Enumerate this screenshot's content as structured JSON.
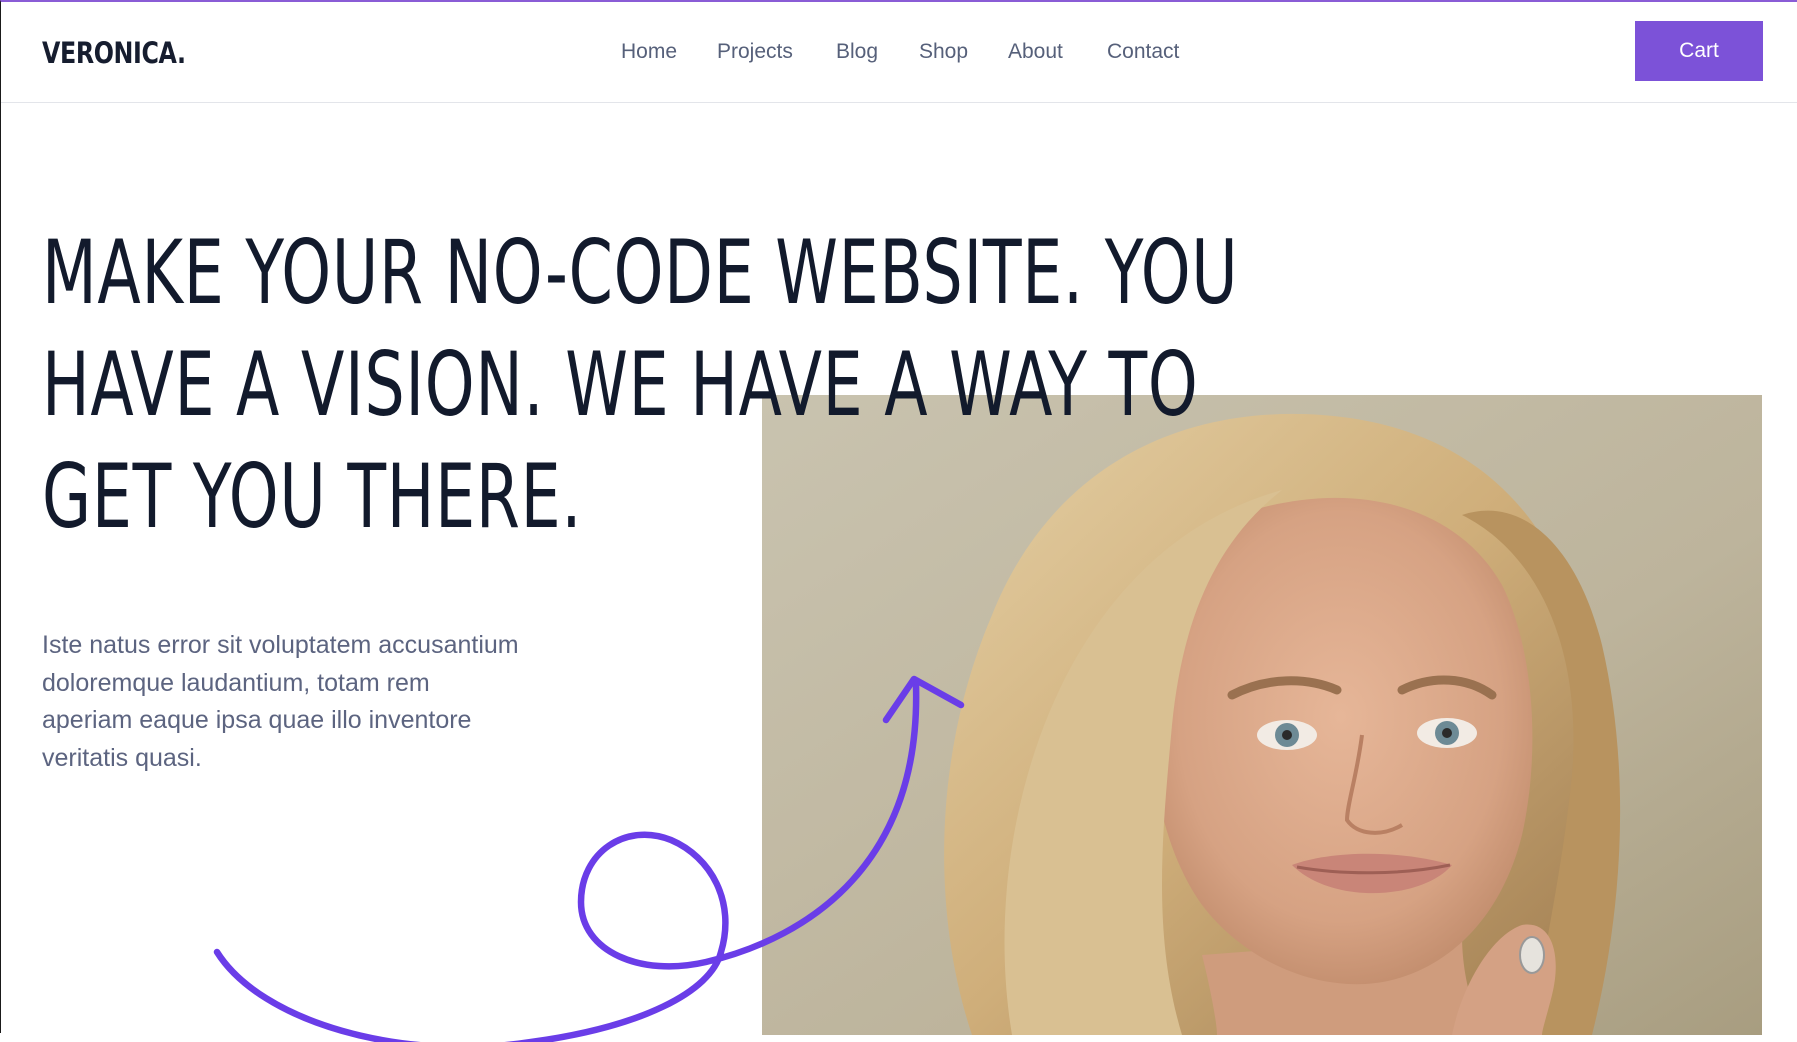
{
  "brand": {
    "name": "VERONICA."
  },
  "nav": {
    "items": [
      "Home",
      "Projects",
      "Blog",
      "Shop",
      "About",
      "Contact"
    ],
    "cart_label": "Cart"
  },
  "hero": {
    "headline_lines": [
      "MAKE YOUR NO-CODE WEBSITE. YOU",
      "HAVE A VISION. WE HAVE A WAY TO",
      "GET YOU THERE."
    ],
    "body": "Iste natus error sit voluptatem accusantium doloremque laudantium, totam rem aperiam eaque ipsa quae illo inventore veritatis quasi."
  },
  "colors": {
    "accent": "#7c52d8",
    "squiggle": "#6a3de8",
    "heading": "#121a2c",
    "body": "#5c6480"
  },
  "icons": {
    "squiggle": "curly-arrow-icon"
  }
}
